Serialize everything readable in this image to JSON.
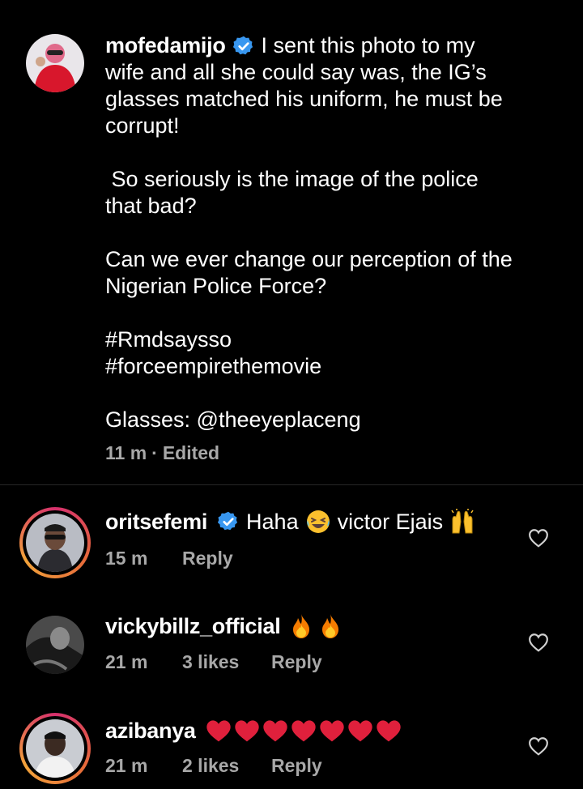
{
  "caption": {
    "username": "mofedamijo",
    "text_first_line": "I sent this photo to my",
    "text_rest": "wife and all she could say was, the IG’s\nglasses matched his uniform, he must be\ncorrupt!\n\n So seriously is the image of the police\nthat bad?\n\nCan we ever change our perception of the\nNigerian Police Force?\n\n#Rmdsaysso\n#forceempirethemovie\n\nGlasses: @theeyeplaceng",
    "time": "11 m",
    "separator": "·",
    "edited": "Edited"
  },
  "comments": [
    {
      "username": "oritsefemi",
      "verified": true,
      "text_a": "Haha",
      "text_b": "victor Ejais",
      "time": "15 m",
      "likes": "",
      "reply": "Reply"
    },
    {
      "username": "vickybillz_official",
      "verified": false,
      "time": "21 m",
      "likes": "3 likes",
      "reply": "Reply"
    },
    {
      "username": "azibanya",
      "verified": false,
      "time": "21 m",
      "likes": "2 likes",
      "reply": "Reply"
    }
  ],
  "colors": {
    "background": "#000000",
    "text": "#ffffff",
    "muted": "#a8a8a8",
    "verified": "#3897f0",
    "heart_red": "#e0203c",
    "fire": "#f7931e"
  },
  "icons": [
    "verified-badge-icon",
    "laughing-emoji-icon",
    "raising-hands-emoji-icon",
    "fire-emoji-icon",
    "red-heart-emoji-icon",
    "heart-outline-icon"
  ]
}
